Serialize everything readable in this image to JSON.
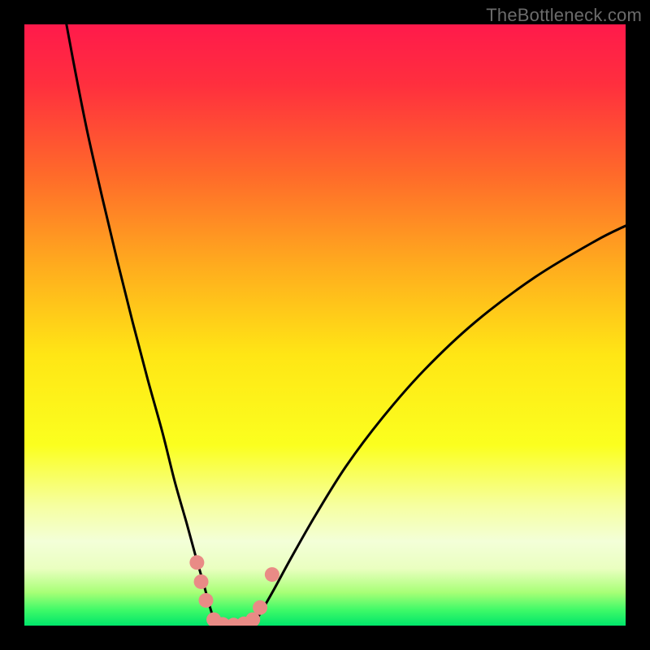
{
  "watermark": "TheBottleneck.com",
  "chart_data": {
    "type": "line",
    "title": "",
    "xlabel": "",
    "ylabel": "",
    "xlim": [
      0,
      100
    ],
    "ylim": [
      0,
      100
    ],
    "grid": false,
    "legend": false,
    "gradient_stops": [
      {
        "offset": 0.0,
        "color": "#ff1a4b"
      },
      {
        "offset": 0.1,
        "color": "#ff2f3e"
      },
      {
        "offset": 0.25,
        "color": "#ff6a2a"
      },
      {
        "offset": 0.4,
        "color": "#ffab1e"
      },
      {
        "offset": 0.55,
        "color": "#ffe615"
      },
      {
        "offset": 0.7,
        "color": "#fbff1f"
      },
      {
        "offset": 0.8,
        "color": "#f6ffa0"
      },
      {
        "offset": 0.86,
        "color": "#f3ffd8"
      },
      {
        "offset": 0.905,
        "color": "#eaffc0"
      },
      {
        "offset": 0.945,
        "color": "#a7ff76"
      },
      {
        "offset": 0.975,
        "color": "#3cf968"
      },
      {
        "offset": 1.0,
        "color": "#00e56a"
      }
    ],
    "series": [
      {
        "name": "left-branch",
        "x": [
          7.0,
          8.5,
          10.5,
          13.0,
          15.5,
          18.0,
          20.5,
          23.0,
          25.0,
          27.0,
          28.5,
          29.8,
          30.6,
          31.2,
          31.6
        ],
        "y": [
          100.0,
          92.0,
          82.0,
          71.0,
          60.5,
          50.5,
          41.0,
          32.0,
          24.0,
          17.0,
          11.5,
          7.0,
          4.0,
          2.0,
          0.8
        ]
      },
      {
        "name": "right-branch",
        "x": [
          38.5,
          39.5,
          41.5,
          44.5,
          48.5,
          53.5,
          59.5,
          66.5,
          75.0,
          85.0,
          95.0,
          100.0
        ],
        "y": [
          0.8,
          2.5,
          6.0,
          11.5,
          18.5,
          26.5,
          34.5,
          42.5,
          50.5,
          58.0,
          64.0,
          66.5
        ]
      },
      {
        "name": "valley-floor",
        "x": [
          31.6,
          32.5,
          33.5,
          34.5,
          35.5,
          36.5,
          37.5,
          38.5
        ],
        "y": [
          0.8,
          0.3,
          0.1,
          0.05,
          0.05,
          0.1,
          0.3,
          0.8
        ]
      }
    ],
    "markers": [
      {
        "x": 28.7,
        "y": 10.5
      },
      {
        "x": 29.4,
        "y": 7.3
      },
      {
        "x": 30.2,
        "y": 4.2
      },
      {
        "x": 31.5,
        "y": 1.0
      },
      {
        "x": 33.0,
        "y": 0.2
      },
      {
        "x": 34.8,
        "y": 0.1
      },
      {
        "x": 36.5,
        "y": 0.3
      },
      {
        "x": 38.0,
        "y": 1.0
      },
      {
        "x": 39.2,
        "y": 3.0
      },
      {
        "x": 41.2,
        "y": 8.5
      }
    ],
    "marker_color": "#e98b86",
    "curve_color": "#000000"
  }
}
